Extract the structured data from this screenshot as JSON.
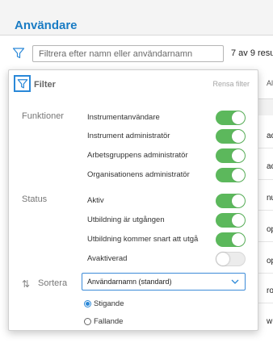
{
  "app": {
    "title": "Användare"
  },
  "toolbar": {
    "search_placeholder": "Filtrera efter namn eller användarnamn",
    "search_value": "",
    "count_text": "7 av 9 resu"
  },
  "table": {
    "column_header": "Al",
    "rows": [
      "ac",
      "ac",
      "nu",
      "op",
      "op",
      "ro",
      "w"
    ]
  },
  "filter_panel": {
    "title": "Filter",
    "clear_label": "Rensa filter",
    "functions": {
      "label": "Funktioner",
      "options": [
        {
          "label": "Instrumentanvändare",
          "enabled": true
        },
        {
          "label": "Instrument administratör",
          "enabled": true
        },
        {
          "label": "Arbetsgruppens administratör",
          "enabled": true
        },
        {
          "label": "Organisationens administratör",
          "enabled": true
        }
      ]
    },
    "status": {
      "label": "Status",
      "options": [
        {
          "label": "Aktiv",
          "enabled": true
        },
        {
          "label": "Utbildning är utgången",
          "enabled": true
        },
        {
          "label": "Utbildning kommer snart att utgå",
          "enabled": true
        },
        {
          "label": "Avaktiverad",
          "enabled": false
        }
      ]
    },
    "sort": {
      "label": "Sortera",
      "selected": "Användarnamn (standard)",
      "order_options": [
        {
          "label": "Stigande",
          "selected": true
        },
        {
          "label": "Fallande",
          "selected": false
        }
      ]
    }
  },
  "colors": {
    "accent": "#1a7cc4",
    "toggle_on": "#5cb85c",
    "focus_border": "#2a88d8"
  }
}
